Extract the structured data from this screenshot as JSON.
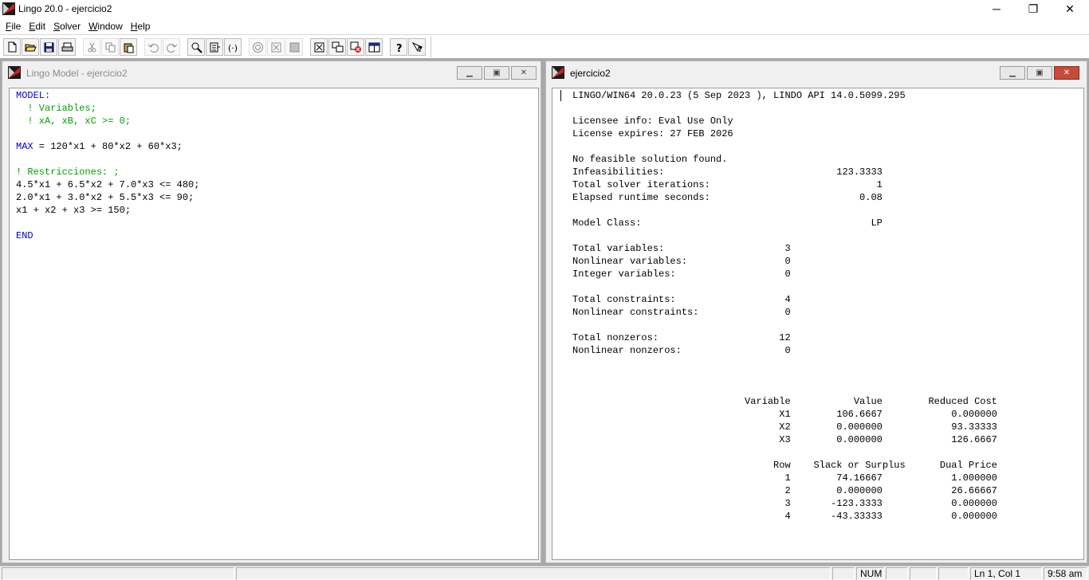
{
  "app": {
    "title": "Lingo 20.0 - ejercicio2",
    "window_controls": {
      "minimize": "─",
      "maximize": "❐",
      "close": "✕"
    }
  },
  "menu": [
    "File",
    "Edit",
    "Solver",
    "Window",
    "Help"
  ],
  "toolbar": {
    "buttons": [
      {
        "name": "new-file-icon",
        "enabled": true
      },
      {
        "name": "open-folder-icon",
        "enabled": true
      },
      {
        "name": "save-disk-icon",
        "enabled": true
      },
      {
        "name": "print-icon",
        "enabled": true
      },
      {
        "name": "cut-icon",
        "enabled": false
      },
      {
        "name": "copy-icon",
        "enabled": false
      },
      {
        "name": "paste-icon",
        "enabled": true
      },
      {
        "name": "undo-icon",
        "enabled": false
      },
      {
        "name": "redo-icon",
        "enabled": false
      },
      {
        "name": "find-icon",
        "enabled": true
      },
      {
        "name": "goto-line-icon",
        "enabled": true
      },
      {
        "name": "match-paren-icon",
        "enabled": true
      },
      {
        "name": "solve-icon",
        "enabled": false
      },
      {
        "name": "solution-icon",
        "enabled": false
      },
      {
        "name": "matrix-picture-icon",
        "enabled": false
      },
      {
        "name": "options-icon",
        "enabled": true
      },
      {
        "name": "send-to-back-icon",
        "enabled": true
      },
      {
        "name": "close-all-icon",
        "enabled": true
      },
      {
        "name": "tile-icon",
        "enabled": true
      },
      {
        "name": "help-icon",
        "enabled": true
      },
      {
        "name": "context-help-icon",
        "enabled": true
      }
    ]
  },
  "model_window": {
    "title": "Lingo Model - ejercicio2",
    "lines": [
      {
        "text": "MODEL:",
        "style": "kw"
      },
      {
        "text": "  ! Variables;",
        "style": "cm"
      },
      {
        "text": "  ! xA, xB, xC >= 0;",
        "style": "cm"
      },
      {
        "text": "",
        "style": ""
      },
      {
        "parts": [
          {
            "text": "MAX",
            "style": "kw"
          },
          {
            "text": " = 120*x1 + 80*x2 + 60*x3;",
            "style": ""
          }
        ]
      },
      {
        "text": "",
        "style": ""
      },
      {
        "text": "! Restricciones: ;",
        "style": "cm"
      },
      {
        "text": "4.5*x1 + 6.5*x2 + 7.0*x3 <= 480;",
        "style": ""
      },
      {
        "text": "2.0*x1 + 3.0*x2 + 5.5*x3 <= 90;",
        "style": ""
      },
      {
        "text": "x1 + x2 + x3 >= 150;",
        "style": ""
      },
      {
        "text": "",
        "style": ""
      },
      {
        "text": "END",
        "style": "kw"
      }
    ]
  },
  "report_window": {
    "title": "ejercicio2",
    "lines": [
      "LINGO/WIN64 20.0.23 (5 Sep 2023 ), LINDO API 14.0.5099.295",
      "",
      "Licensee info: Eval Use Only",
      "License expires: 27 FEB 2026",
      "",
      "No feasible solution found.",
      "Infeasibilities:                              123.3333",
      "Total solver iterations:                             1",
      "Elapsed runtime seconds:                          0.08",
      "",
      "Model Class:                                        LP",
      "",
      "Total variables:                     3",
      "Nonlinear variables:                 0",
      "Integer variables:                   0",
      "",
      "Total constraints:                   4",
      "Nonlinear constraints:               0",
      "",
      "Total nonzeros:                     12",
      "Nonlinear nonzeros:                  0",
      "",
      "",
      "",
      "                              Variable           Value        Reduced Cost",
      "                                    X1        106.6667            0.000000",
      "                                    X2        0.000000            93.33333",
      "                                    X3        0.000000            126.6667",
      "",
      "                                   Row    Slack or Surplus      Dual Price",
      "                                     1        74.16667            1.000000",
      "                                     2        0.000000            26.66667",
      "                                     3       -123.3333            0.000000",
      "                                     4       -43.33333            0.000000"
    ]
  },
  "status_bar": {
    "num": "NUM",
    "position": "Ln 1, Col 1",
    "time": "9:58 am"
  },
  "colors": {
    "keyword": "#0000c8",
    "comment": "#00a000",
    "mdi_background": "#a8a8a8",
    "close_red": "#c84a3a"
  }
}
